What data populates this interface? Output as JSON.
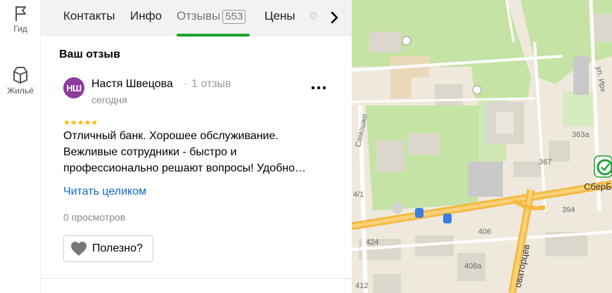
{
  "rail": {
    "items": [
      {
        "label": "Гид",
        "icon": "flag-icon"
      },
      {
        "label": "Жильё",
        "icon": "house-icon"
      }
    ]
  },
  "tabs": {
    "items": [
      {
        "label": "Контакты"
      },
      {
        "label": "Инфо"
      },
      {
        "label": "Отзывы",
        "count": "553",
        "active": true
      },
      {
        "label": "Цены"
      },
      {
        "label": "Ф"
      }
    ]
  },
  "section": {
    "title": "Ваш отзыв"
  },
  "review": {
    "avatar_initials": "НШ",
    "author": "Настя Швецова",
    "separator": "·",
    "review_count": "1 отзыв",
    "date": "сегодня",
    "rating": 5,
    "stars": "★★★★★",
    "text": "Отличный банк. Хорошее обслуживание. Вежливые сотрудники - быстро и профессионально решают вопросы! Удобно…",
    "read_more": "Читать целиком",
    "views": "0 просмотров",
    "useful_label": "Полезно?"
  },
  "map": {
    "labels": {
      "street_samoshko": "Самошко",
      "street_novatortsev": "оваторцев",
      "bank": "СберБ",
      "n363a": "363а",
      "n367": "367",
      "n394": "394",
      "n406": "406",
      "n424": "424",
      "n408a": "408а",
      "n411": "4/1",
      "n412": "412",
      "street_right": "ул. Ирк"
    },
    "colors": {
      "park": "#c5e3a4",
      "road": "#f5b942",
      "building": "#dcd7cc",
      "bank_green": "#21a038"
    }
  }
}
